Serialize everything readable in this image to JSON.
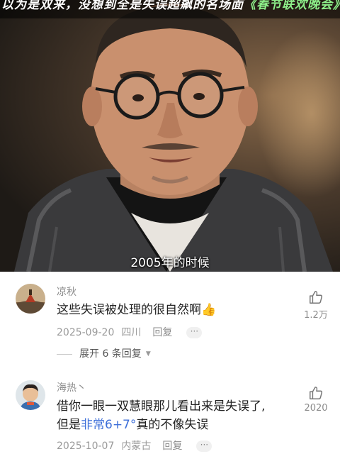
{
  "video": {
    "headline_part1": "以为是双来，没想到全是失误超飙的名场面",
    "headline_part2": "《春节联欢晚会》",
    "subtitle": "2005年的时候"
  },
  "comments": [
    {
      "username": "凉秋",
      "text": "这些失误被处理的很自然啊👍",
      "date": "2025-09-20",
      "location": "四川",
      "reply_label": "回复",
      "more_label": "···",
      "like_count": "1.2万",
      "expand_label": "展开 6 条回复"
    },
    {
      "username": "海热丶",
      "text_line1": "借你一眼一双慧眼那儿看出来是失误了,",
      "text_line2_prefix": "但是",
      "text_line2_highlight": "非常6+7°",
      "text_line2_suffix": "真的不像失误",
      "date": "2025-10-07",
      "location": "内蒙古",
      "reply_label": "回复",
      "more_label": "···",
      "like_count": "2020"
    }
  ],
  "colors": {
    "highlight_link": "#3d6fd9",
    "username": "#8b8b8b",
    "headline_accent": "#8ef08a"
  },
  "icons": [
    "thumbs-up-emoji",
    "like-thumb-icon",
    "chevron-down-icon",
    "more-dots-icon"
  ]
}
